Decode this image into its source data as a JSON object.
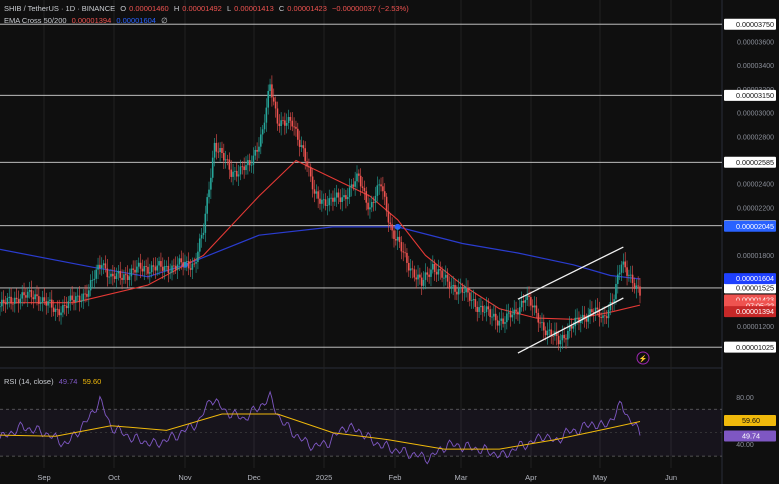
{
  "header": {
    "symbol": "SHIB / TetherUS · 1D · BINANCE",
    "o_label": "O",
    "o_value": "0.00001460",
    "h_label": "H",
    "h_value": "0.00001492",
    "l_label": "L",
    "l_value": "0.00001413",
    "c_label": "C",
    "c_value": "0.00001423",
    "change": "−0.00000037 (−2.53%)",
    "ema_title": "EMA Cross 50/200",
    "ema_fast": "0.00001394",
    "ema_slow": "0.00001604",
    "ema_extra": "∅"
  },
  "rsi": {
    "title": "RSI (14, close)",
    "value": "49.74",
    "ma": "59.60"
  },
  "colors": {
    "bg": "#0f0f0f",
    "up": "#26a69a",
    "down": "#ef5350",
    "ema50": "#e53935",
    "ema200": "#2a3ccf",
    "rsi": "#7e57c2",
    "rsi_ma": "#f0b90b",
    "grid": "#222"
  },
  "chart_data": {
    "type": "candlestick",
    "timeframe": "1D",
    "x_ticks": [
      "Sep",
      "Oct",
      "Nov",
      "Dec",
      "2025",
      "Feb",
      "Mar",
      "Apr",
      "May",
      "Jun"
    ],
    "price_ticks": [
      "0.00003600",
      "0.00003400",
      "0.00003200",
      "0.00003000",
      "0.00002800",
      "0.00002400",
      "0.00002200",
      "0.00001800",
      "0.00001200"
    ],
    "ylim": [
      9e-06,
      3.87e-05
    ],
    "horizontal_levels": [
      {
        "value": 3.75e-05,
        "label": "0.00003750"
      },
      {
        "value": 3.15e-05,
        "label": "0.00003150"
      },
      {
        "value": 2.585e-05,
        "label": "0.00002585"
      },
      {
        "value": 2.05e-05,
        "label": "0.00002050"
      },
      {
        "value": 1.525e-05,
        "label": "0.00001525"
      },
      {
        "value": 1.025e-05,
        "label": "0.00001025"
      }
    ],
    "price_badges": [
      {
        "label": "0.00002045",
        "value": 2.045e-05,
        "color": "#2962ff"
      },
      {
        "label": "0.00001604",
        "value": 1.604e-05,
        "color": "#1e40ff"
      },
      {
        "label": "0.00001423",
        "value": 1.423e-05,
        "color": "#ef5350"
      },
      {
        "label": "07:05:22",
        "value": 1.373e-05,
        "color": "#ef5350"
      },
      {
        "label": "0.00001394",
        "value": 1.325e-05,
        "color": "#c62828"
      }
    ],
    "channel": {
      "upper": [
        {
          "date": "Mar 28",
          "price": 1.43e-05
        },
        {
          "date": "May 24",
          "price": 1.87e-05
        }
      ],
      "lower": [
        {
          "date": "Mar 28",
          "price": 9.75e-06
        },
        {
          "date": "May 24",
          "price": 1.44e-05
        }
      ]
    },
    "price_path": [
      [
        0,
        1.37
      ],
      [
        10,
        1.45
      ],
      [
        20,
        1.46
      ],
      [
        30,
        1.33
      ],
      [
        40,
        1.42
      ],
      [
        48,
        1.5
      ],
      [
        55,
        1.76
      ],
      [
        60,
        1.6
      ],
      [
        70,
        1.65
      ],
      [
        78,
        1.7
      ],
      [
        88,
        1.69
      ],
      [
        98,
        1.72
      ],
      [
        105,
        1.73
      ],
      [
        110,
        2.0
      ],
      [
        116,
        2.75
      ],
      [
        125,
        2.5
      ],
      [
        135,
        2.55
      ],
      [
        142,
        2.85
      ],
      [
        146,
        3.22
      ],
      [
        150,
        2.95
      ],
      [
        158,
        2.9
      ],
      [
        164,
        2.7
      ],
      [
        170,
        2.3
      ],
      [
        178,
        2.25
      ],
      [
        186,
        2.3
      ],
      [
        194,
        2.45
      ],
      [
        200,
        2.2
      ],
      [
        206,
        2.4
      ],
      [
        212,
        2.0
      ],
      [
        220,
        1.75
      ],
      [
        228,
        1.55
      ],
      [
        234,
        1.72
      ],
      [
        242,
        1.56
      ],
      [
        250,
        1.5
      ],
      [
        258,
        1.38
      ],
      [
        266,
        1.28
      ],
      [
        272,
        1.25
      ],
      [
        278,
        1.3
      ],
      [
        284,
        1.46
      ],
      [
        290,
        1.3
      ],
      [
        296,
        1.15
      ],
      [
        302,
        1.08
      ],
      [
        308,
        1.18
      ],
      [
        314,
        1.26
      ],
      [
        320,
        1.34
      ],
      [
        326,
        1.26
      ],
      [
        332,
        1.46
      ],
      [
        336,
        1.72
      ],
      [
        340,
        1.66
      ],
      [
        346,
        1.46
      ]
    ],
    "ema50_path": [
      [
        0,
        1.4
      ],
      [
        40,
        1.4
      ],
      [
        80,
        1.55
      ],
      [
        110,
        1.8
      ],
      [
        140,
        2.3
      ],
      [
        160,
        2.6
      ],
      [
        180,
        2.45
      ],
      [
        200,
        2.3
      ],
      [
        215,
        2.1
      ],
      [
        230,
        1.8
      ],
      [
        250,
        1.55
      ],
      [
        270,
        1.35
      ],
      [
        290,
        1.27
      ],
      [
        310,
        1.26
      ],
      [
        330,
        1.32
      ],
      [
        346,
        1.38
      ]
    ],
    "ema200_path": [
      [
        0,
        1.85
      ],
      [
        50,
        1.7
      ],
      [
        80,
        1.62
      ],
      [
        100,
        1.72
      ],
      [
        140,
        1.97
      ],
      [
        180,
        2.04
      ],
      [
        215,
        2.04
      ],
      [
        250,
        1.9
      ],
      [
        280,
        1.82
      ],
      [
        310,
        1.72
      ],
      [
        330,
        1.63
      ],
      [
        346,
        1.6
      ]
    ],
    "rsi_ticks": [
      "80.00",
      "40.00"
    ],
    "rsi_ylim": [
      25,
      95
    ],
    "rsi_bands": [
      70,
      30
    ],
    "rsi_path": [
      [
        0,
        45
      ],
      [
        12,
        55
      ],
      [
        24,
        50
      ],
      [
        36,
        40
      ],
      [
        48,
        62
      ],
      [
        54,
        78
      ],
      [
        60,
        55
      ],
      [
        72,
        45
      ],
      [
        84,
        40
      ],
      [
        96,
        48
      ],
      [
        108,
        60
      ],
      [
        114,
        80
      ],
      [
        122,
        68
      ],
      [
        132,
        62
      ],
      [
        140,
        72
      ],
      [
        146,
        80
      ],
      [
        152,
        60
      ],
      [
        162,
        45
      ],
      [
        170,
        38
      ],
      [
        178,
        42
      ],
      [
        186,
        55
      ],
      [
        194,
        52
      ],
      [
        202,
        42
      ],
      [
        212,
        36
      ],
      [
        222,
        32
      ],
      [
        232,
        28
      ],
      [
        242,
        40
      ],
      [
        252,
        38
      ],
      [
        262,
        35
      ],
      [
        272,
        30
      ],
      [
        280,
        38
      ],
      [
        288,
        42
      ],
      [
        294,
        48
      ],
      [
        300,
        42
      ],
      [
        306,
        50
      ],
      [
        312,
        52
      ],
      [
        320,
        58
      ],
      [
        326,
        55
      ],
      [
        332,
        64
      ],
      [
        336,
        75
      ],
      [
        340,
        62
      ],
      [
        346,
        49.74
      ]
    ],
    "rsi_ma_path": [
      [
        0,
        48
      ],
      [
        30,
        47
      ],
      [
        60,
        56
      ],
      [
        90,
        52
      ],
      [
        120,
        66
      ],
      [
        150,
        66
      ],
      [
        180,
        50
      ],
      [
        210,
        44
      ],
      [
        240,
        36
      ],
      [
        270,
        36
      ],
      [
        300,
        44
      ],
      [
        330,
        54
      ],
      [
        346,
        59.6
      ]
    ]
  }
}
